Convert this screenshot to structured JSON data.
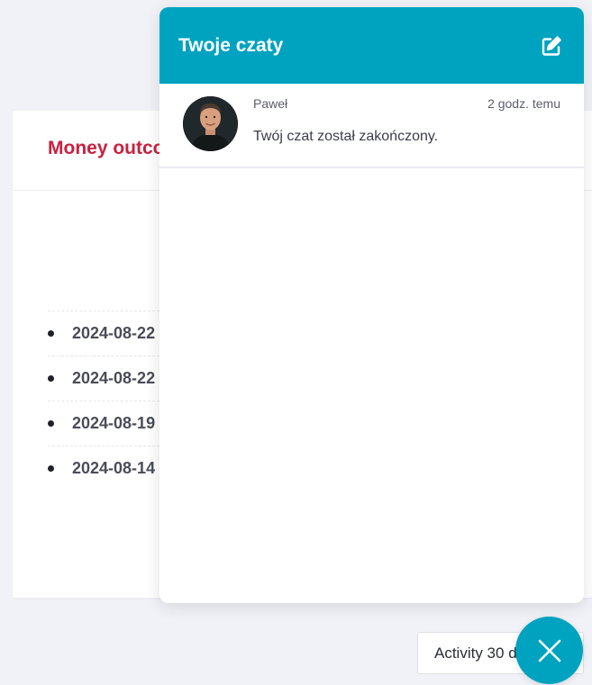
{
  "background_card": {
    "title": "Money outco",
    "dates": [
      "2024-08-22",
      "2024-08-22",
      "2024-08-19",
      "2024-08-14"
    ]
  },
  "activity_button": {
    "label": "Activity 30 d"
  },
  "chat_panel": {
    "title": "Twoje czaty",
    "edit_icon": "edit-icon",
    "chats": [
      {
        "name": "Paweł",
        "time": "2 godz. temu",
        "message": "Twój czat został zakończony."
      }
    ]
  },
  "close_icon": "close-icon",
  "colors": {
    "accent": "#00a3bf",
    "title_red": "#c8213f",
    "page_bg": "#f1f2f7"
  }
}
